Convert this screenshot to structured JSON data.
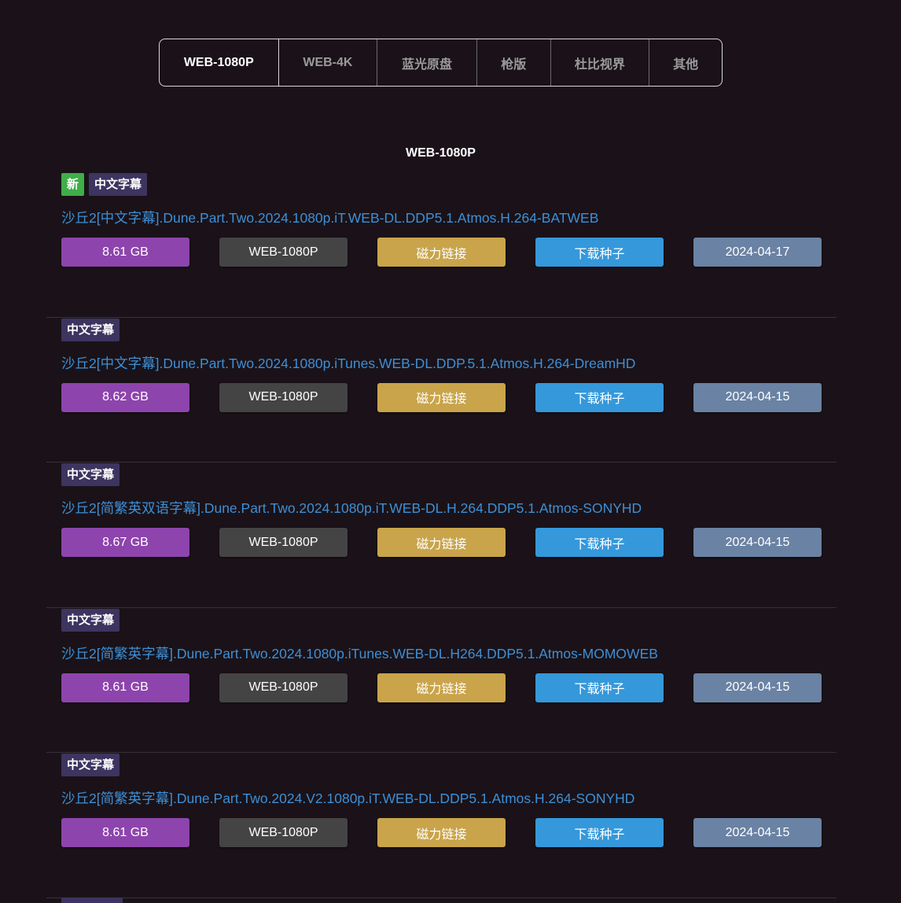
{
  "tabs": [
    {
      "label": "WEB-1080P",
      "width": 152
    },
    {
      "label": "WEB-4K",
      "width": 125
    },
    {
      "label": "蓝光原盘",
      "width": 127
    },
    {
      "label": "枪版",
      "width": 94
    },
    {
      "label": "杜比视界",
      "width": 126
    },
    {
      "label": "其他",
      "width": 93
    }
  ],
  "section_title": "WEB-1080P",
  "entries": [
    {
      "tags": [
        {
          "label": "新",
          "type": "new"
        },
        {
          "label": "中文字幕",
          "type": "sub"
        }
      ],
      "title": "沙丘2[中文字幕].Dune.Part.Two.2024.1080p.iT.WEB-DL.DDP5.1.Atmos.H.264-BATWEB",
      "size": "8.61 GB",
      "quality": "WEB-1080P",
      "magnet": "磁力链接",
      "torrent": "下载种子",
      "date": "2024-04-17"
    },
    {
      "tags": [
        {
          "label": "中文字幕",
          "type": "sub"
        }
      ],
      "title": "沙丘2[中文字幕].Dune.Part.Two.2024.1080p.iTunes.WEB-DL.DDP.5.1.Atmos.H.264-DreamHD",
      "size": "8.62 GB",
      "quality": "WEB-1080P",
      "magnet": "磁力链接",
      "torrent": "下载种子",
      "date": "2024-04-15"
    },
    {
      "tags": [
        {
          "label": "中文字幕",
          "type": "sub"
        }
      ],
      "title": "沙丘2[简繁英双语字幕].Dune.Part.Two.2024.1080p.iT.WEB-DL.H.264.DDP5.1.Atmos-SONYHD",
      "size": "8.67 GB",
      "quality": "WEB-1080P",
      "magnet": "磁力链接",
      "torrent": "下载种子",
      "date": "2024-04-15"
    },
    {
      "tags": [
        {
          "label": "中文字幕",
          "type": "sub"
        }
      ],
      "title": "沙丘2[简繁英字幕].Dune.Part.Two.2024.1080p.iTunes.WEB-DL.H264.DDP5.1.Atmos-MOMOWEB",
      "size": "8.61 GB",
      "quality": "WEB-1080P",
      "magnet": "磁力链接",
      "torrent": "下载种子",
      "date": "2024-04-15"
    },
    {
      "tags": [
        {
          "label": "中文字幕",
          "type": "sub"
        }
      ],
      "title": "沙丘2[简繁英字幕].Dune.Part.Two.2024.V2.1080p.iT.WEB-DL.DDP5.1.Atmos.H.264-SONYHD",
      "size": "8.61 GB",
      "quality": "WEB-1080P",
      "magnet": "磁力链接",
      "torrent": "下载种子",
      "date": "2024-04-15"
    }
  ],
  "colors": {
    "background": "#1a1218",
    "link": "#3d8fd6",
    "size_button": "#8e44ad",
    "quality_button": "#444444",
    "magnet_button": "#c9a44a",
    "torrent_button": "#3498db",
    "date_button": "#6a82a3",
    "tag_new": "#3fae49",
    "tag_sub": "#3d3460"
  }
}
